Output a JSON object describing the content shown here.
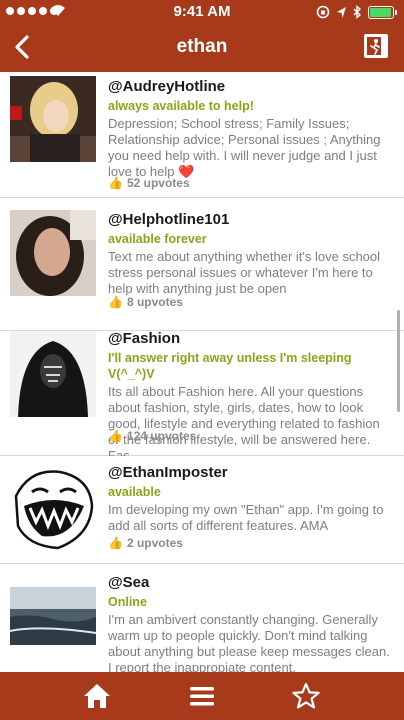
{
  "status_bar": {
    "time": "9:41 AM"
  },
  "nav": {
    "title": "ethan"
  },
  "posts": [
    {
      "handle": "@AudreyHotline",
      "status": "always available to help!",
      "description": "Depression; School stress; Family Issues; Relationship advice; Personal issues ;  Anything you need help with. I will never judge and I just love to help ❤️",
      "upvotes": "52 upvotes"
    },
    {
      "handle": "@Helphotline101",
      "status": "available forever",
      "description": "Text me about anything whether it's love school stress personal issues or whatever I'm here to help with anything just be open",
      "upvotes": "8 upvotes"
    },
    {
      "handle": "@Fashion",
      "status": "I'll answer right away unless I'm sleeping V(^_^)V",
      "description": "Its all about Fashion here. All your questions about fashion, style, girls, dates, how to look good, lifestyle and everything related to fashion or the fashion lifestyle, will be answered here. Fas...",
      "upvotes": "124 upvotes"
    },
    {
      "handle": "@EthanImposter",
      "status": "available",
      "description": "Im developing my own \"Ethan\" app.  I'm going to add all sorts of different features. AMA",
      "upvotes": "2 upvotes"
    },
    {
      "handle": "@Sea",
      "status": "Online",
      "description": "I'm an ambivert constantly changing. Generally warm up to people quickly. Don't mind talking about anything but please keep messages clean. I report the inappropiate content.",
      "upvotes": ""
    }
  ],
  "colors": {
    "brand": "#a63a1a",
    "status_green": "#8aa51a",
    "desc_gray": "#7d7d86"
  },
  "icons": {
    "back": "chevron-left-icon",
    "exit": "exit-door-icon",
    "thumb": "thumbs-up-icon",
    "home": "home-icon",
    "menu": "menu-icon",
    "star": "star-icon"
  }
}
